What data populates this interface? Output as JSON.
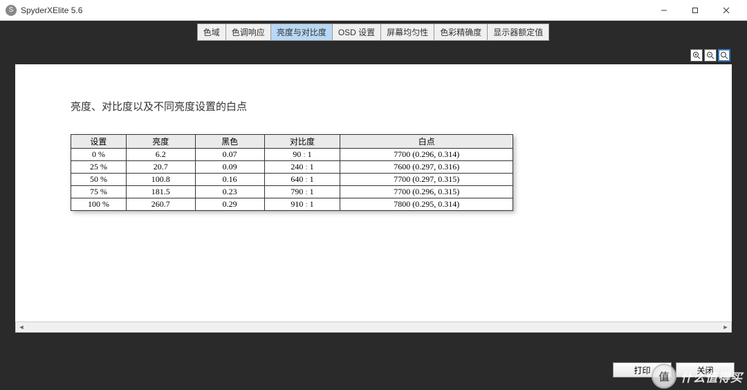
{
  "window": {
    "icon_letter": "S",
    "title": "SpyderXElite 5.6"
  },
  "tabs": [
    {
      "label": "色域",
      "active": false
    },
    {
      "label": "色调响应",
      "active": false
    },
    {
      "label": "亮度与对比度",
      "active": true
    },
    {
      "label": "OSD 设置",
      "active": false
    },
    {
      "label": "屏幕均匀性",
      "active": false
    },
    {
      "label": "色彩精确度",
      "active": false
    },
    {
      "label": "显示器额定值",
      "active": false
    }
  ],
  "page": {
    "heading": "亮度、对比度以及不同亮度设置的白点"
  },
  "table": {
    "headers": {
      "setting": "设置",
      "brightness": "亮度",
      "black": "黑色",
      "contrast": "对比度",
      "white_point": "白点"
    },
    "rows": [
      {
        "setting": "0 %",
        "brightness": "6.2",
        "black": "0.07",
        "contrast_a": "90",
        "contrast_b": "1",
        "white": "7700 (0.296, 0.314)"
      },
      {
        "setting": "25 %",
        "brightness": "20.7",
        "black": "0.09",
        "contrast_a": "240",
        "contrast_b": "1",
        "white": "7600 (0.297, 0.316)"
      },
      {
        "setting": "50 %",
        "brightness": "100.8",
        "black": "0.16",
        "contrast_a": "640",
        "contrast_b": "1",
        "white": "7700 (0.297, 0.315)"
      },
      {
        "setting": "75 %",
        "brightness": "181.5",
        "black": "0.23",
        "contrast_a": "790",
        "contrast_b": "1",
        "white": "7700 (0.296, 0.315)"
      },
      {
        "setting": "100 %",
        "brightness": "260.7",
        "black": "0.29",
        "contrast_a": "910",
        "contrast_b": "1",
        "white": "7800 (0.295, 0.314)"
      }
    ]
  },
  "actions": {
    "print": "打印",
    "close": "关闭"
  },
  "watermark": {
    "badge": "值",
    "text": "什么值得买"
  },
  "chart_data": {
    "type": "table",
    "title": "亮度、对比度以及不同亮度设置的白点",
    "columns": [
      "设置",
      "亮度",
      "黑色",
      "对比度",
      "白点"
    ],
    "rows": [
      [
        "0 %",
        "6.2",
        "0.07",
        "90 : 1",
        "7700 (0.296, 0.314)"
      ],
      [
        "25 %",
        "20.7",
        "0.09",
        "240 : 1",
        "7600 (0.297, 0.316)"
      ],
      [
        "50 %",
        "100.8",
        "0.16",
        "640 : 1",
        "7700 (0.297, 0.315)"
      ],
      [
        "75 %",
        "181.5",
        "0.23",
        "790 : 1",
        "7700 (0.296, 0.315)"
      ],
      [
        "100 %",
        "260.7",
        "0.29",
        "910 : 1",
        "7800 (0.295, 0.314)"
      ]
    ]
  }
}
